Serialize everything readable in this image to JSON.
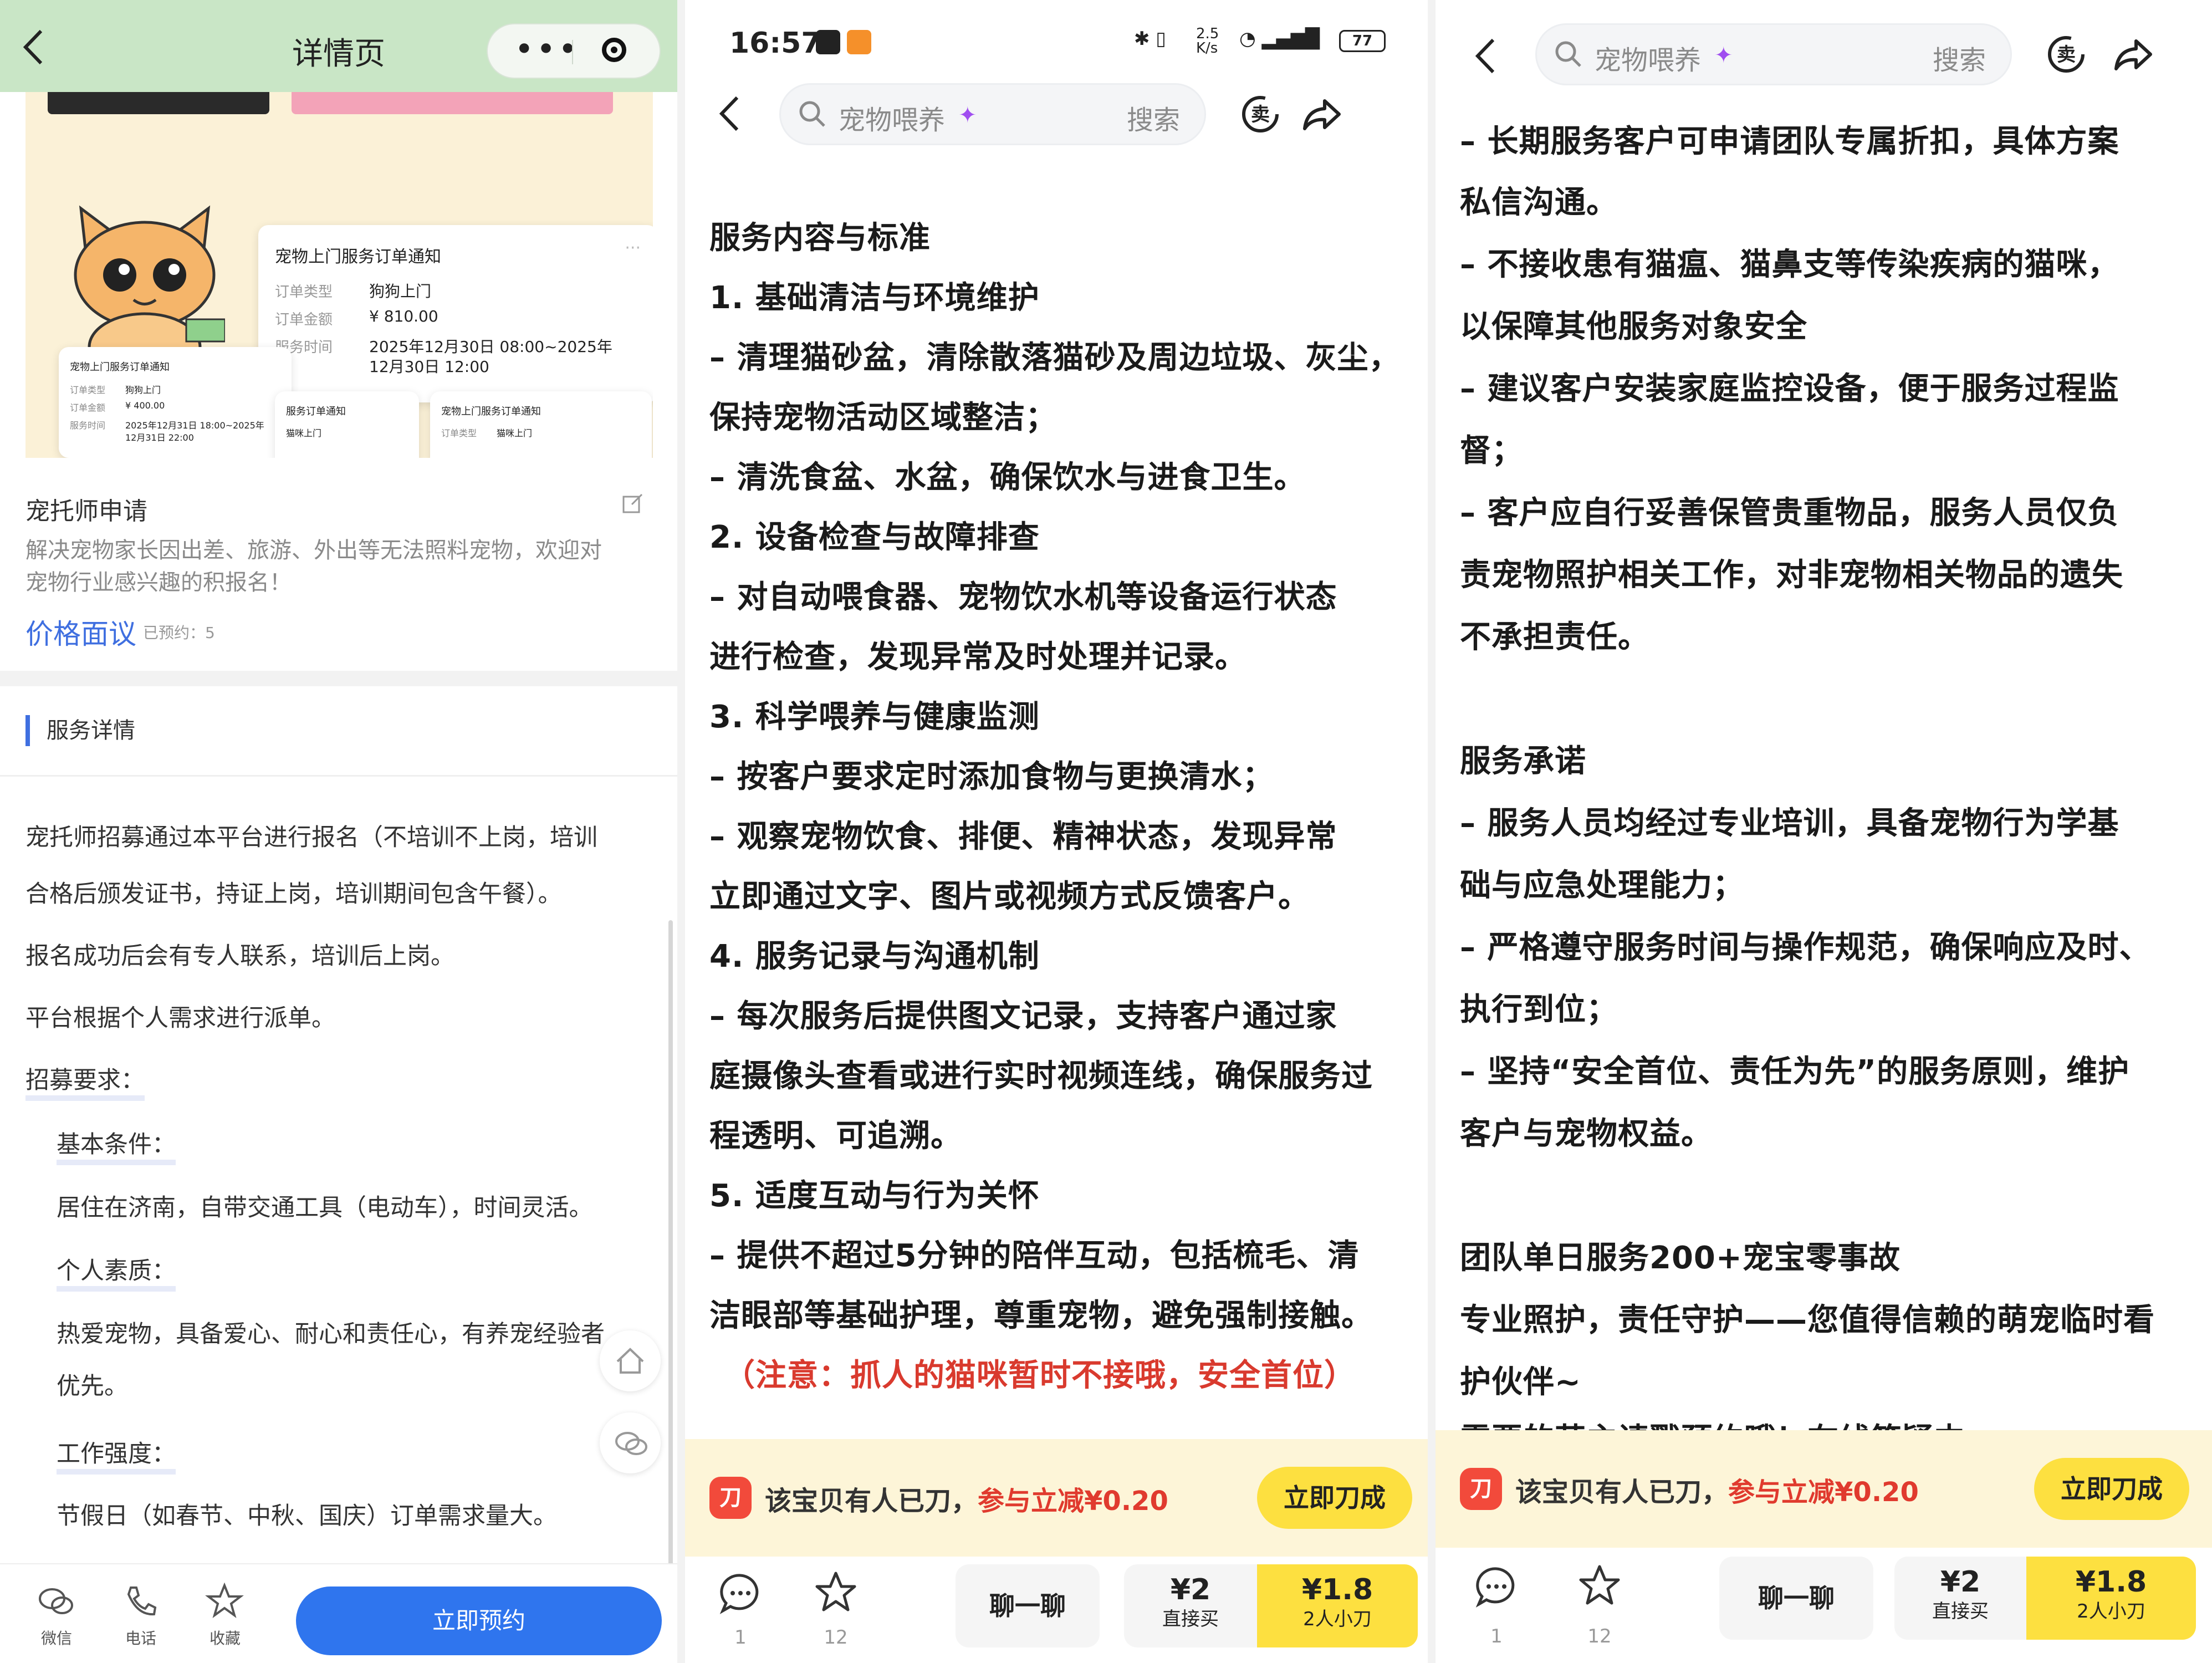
{
  "panel1": {
    "header": {
      "back": "<",
      "title": "详情页",
      "capsule_dots": "•••"
    },
    "banner": {
      "card_main": {
        "title": "宠物上门服务订单通知",
        "more": "···",
        "rows": [
          {
            "label": "订单类型",
            "value": "狗狗上门"
          },
          {
            "label": "订单金额",
            "value": "¥ 810.00"
          },
          {
            "label": "服务时间",
            "value": "2025年12月30日 08:00~2025年",
            "value2": "12月30日 12:00"
          }
        ]
      },
      "card_small1": {
        "title": "宠物上门服务订单通知",
        "rows": [
          {
            "label": "订单类型",
            "value": "狗狗上门"
          },
          {
            "label": "订单金额",
            "value": "¥ 400.00"
          },
          {
            "label": "服务时间",
            "value": "2025年12月31日 18:00~2025年",
            "value2": "12月31日 22:00"
          }
        ]
      },
      "card_small2": {
        "title": "服务订单通知",
        "value": "猫咪上门"
      },
      "card_small3": {
        "title": "宠物上门服务订单通知",
        "label": "订单类型",
        "value": "猫咪上门"
      }
    },
    "apply_title": "宠托师申请",
    "apply_desc_l1": "解决宠物家长因出差、旅游、外出等无法照料宠物，欢迎对",
    "apply_desc_l2": "宠物行业感兴趣的积报名！",
    "price": "价格面议",
    "booked": "已预约：5",
    "section_title": "服务详情",
    "content": [
      "宠托师招募通过本平台进行报名（不培训不上岗，培训",
      "合格后颁发证书，持证上岗，培训期间包含午餐）。",
      "报名成功后会有专人联系，培训后上岗。",
      "平台根据个人需求进行派单。",
      "招募要求：",
      "基本条件：",
      "居住在济南，自带交通工具（电动车），时间灵活。",
      "个人素质：",
      "热爱宠物，具备爱心、耐心和责任心，有养宠经验者",
      "优先。",
      "工作强度：",
      "节假日（如春节、中秋、国庆）订单需求量大。"
    ],
    "bottom": {
      "tabs": [
        "微信",
        "电话",
        "收藏"
      ],
      "reserve": "立即预约"
    }
  },
  "panel2": {
    "status": {
      "time": "16:57",
      "net": "2.5 K/s",
      "battery": "77"
    },
    "search": {
      "placeholder": "宠物喂养",
      "button": "搜索"
    },
    "lines": [
      "服务内容与标准",
      "1. 基础清洁与环境维护",
      "   – 清理猫砂盆，清除散落猫砂及周边垃圾、灰尘，",
      "保持宠物活动区域整洁；",
      "   – 清洗食盆、水盆，确保饮水与进食卫生。",
      "2. 设备检查与故障排查",
      "   – 对自动喂食器、宠物饮水机等设备运行状态",
      "进行检查，发现异常及时处理并记录。",
      "3. 科学喂养与健康监测",
      "   – 按客户要求定时添加食物与更换清水；",
      "   – 观察宠物饮食、排便、精神状态，发现异常",
      "立即通过文字、图片或视频方式反馈客户。",
      "4. 服务记录与沟通机制",
      "   – 每次服务后提供图文记录，支持客户通过家",
      "庭摄像头查看或进行实时视频连线，确保服务过",
      "程透明、可追溯。",
      "5. 适度互动与行为关怀",
      "   – 提供不超过5分钟的陪伴互动，包括梳毛、清",
      "洁眼部等基础护理，尊重宠物，避免强制接触。"
    ],
    "notice": "（注意：抓人的猫咪暂时不接哦，安全首位）",
    "promo": {
      "icon": "刀",
      "text": "该宝贝有人已刀，",
      "highlight": "参与立减¥0.20",
      "button": "立即刀成"
    },
    "bottom": {
      "chat_count": "1",
      "fav_count": "12",
      "chat_btn": "聊一聊",
      "direct_price": "¥2",
      "direct_label": "直接买",
      "group_price": "¥1.8",
      "group_label": "2人小刀"
    }
  },
  "panel3": {
    "search": {
      "placeholder": "宠物喂养",
      "button": "搜索"
    },
    "lines": [
      "– 长期服务客户可申请团队专属折扣，具体方案",
      "私信沟通。",
      "– 不接收患有猫瘟、猫鼻支等传染疾病的猫咪，",
      "以保障其他服务对象安全",
      "– 建议客户安装家庭监控设备，便于服务过程监",
      "督；",
      "– 客户应自行妥善保管贵重物品，服务人员仅负",
      "责宠物照护相关工作，对非宠物相关物品的遗失",
      "不承担责任。",
      "",
      "服务承诺",
      "– 服务人员均经过专业培训，具备宠物行为学基",
      "础与应急处理能力；",
      "– 严格遵守服务时间与操作规范，确保响应及时、",
      "执行到位；",
      "– 坚持“安全首位、责任为先”的服务原则，维护",
      "客户与宠物权益。",
      "",
      "团队单日服务200+宠宝零事故",
      "专业照护，责任守护——您值得信赖的萌宠临时看",
      "护伙伴~",
      "需要的萌主请戳预约哦！在线答疑中"
    ],
    "promo": {
      "icon": "刀",
      "text": "该宝贝有人已刀，",
      "highlight": "参与立减¥0.20",
      "button": "立即刀成"
    },
    "bottom": {
      "chat_count": "1",
      "fav_count": "12",
      "chat_btn": "聊一聊",
      "direct_price": "¥2",
      "direct_label": "直接买",
      "group_price": "¥1.8",
      "group_label": "2人小刀"
    }
  },
  "colors": {
    "header_green": "#c9e6c6",
    "accent_blue": "#2f75ee",
    "promo_yellow": "#fde040",
    "price_red": "#e03a2e"
  }
}
